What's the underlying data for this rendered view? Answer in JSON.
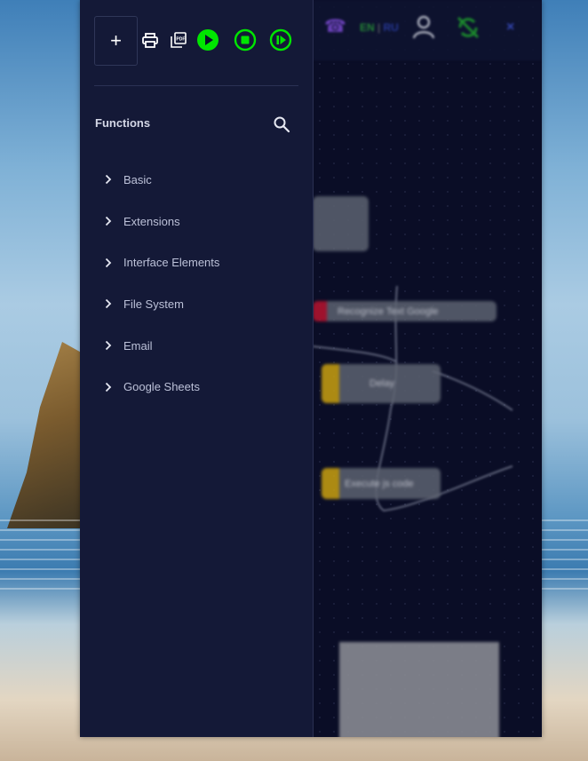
{
  "toolbar": {
    "add_label": "+",
    "buttons": [
      "print-icon",
      "pdf-icon",
      "play-icon",
      "stop-icon",
      "step-icon"
    ],
    "accent_color": "#00e600"
  },
  "sidebar": {
    "section_title": "Functions",
    "categories": [
      {
        "label": "Basic"
      },
      {
        "label": "Extensions"
      },
      {
        "label": "Interface Elements"
      },
      {
        "label": "File System"
      },
      {
        "label": "Email"
      },
      {
        "label": "Google Sheets"
      }
    ]
  },
  "topbar": {
    "lang_en": "EN",
    "lang_sep": "|",
    "lang_ru": "RU",
    "close_label": "×"
  },
  "canvas": {
    "nodes": [
      {
        "label": ""
      },
      {
        "label": "Recognize Text Google"
      },
      {
        "label": "Delay"
      },
      {
        "label": "Execute js code"
      }
    ]
  },
  "colors": {
    "sidebar_bg": "#141937",
    "canvas_bg": "#0a0d26",
    "node_red": "#b8132f",
    "node_yellow": "#c9a010"
  }
}
